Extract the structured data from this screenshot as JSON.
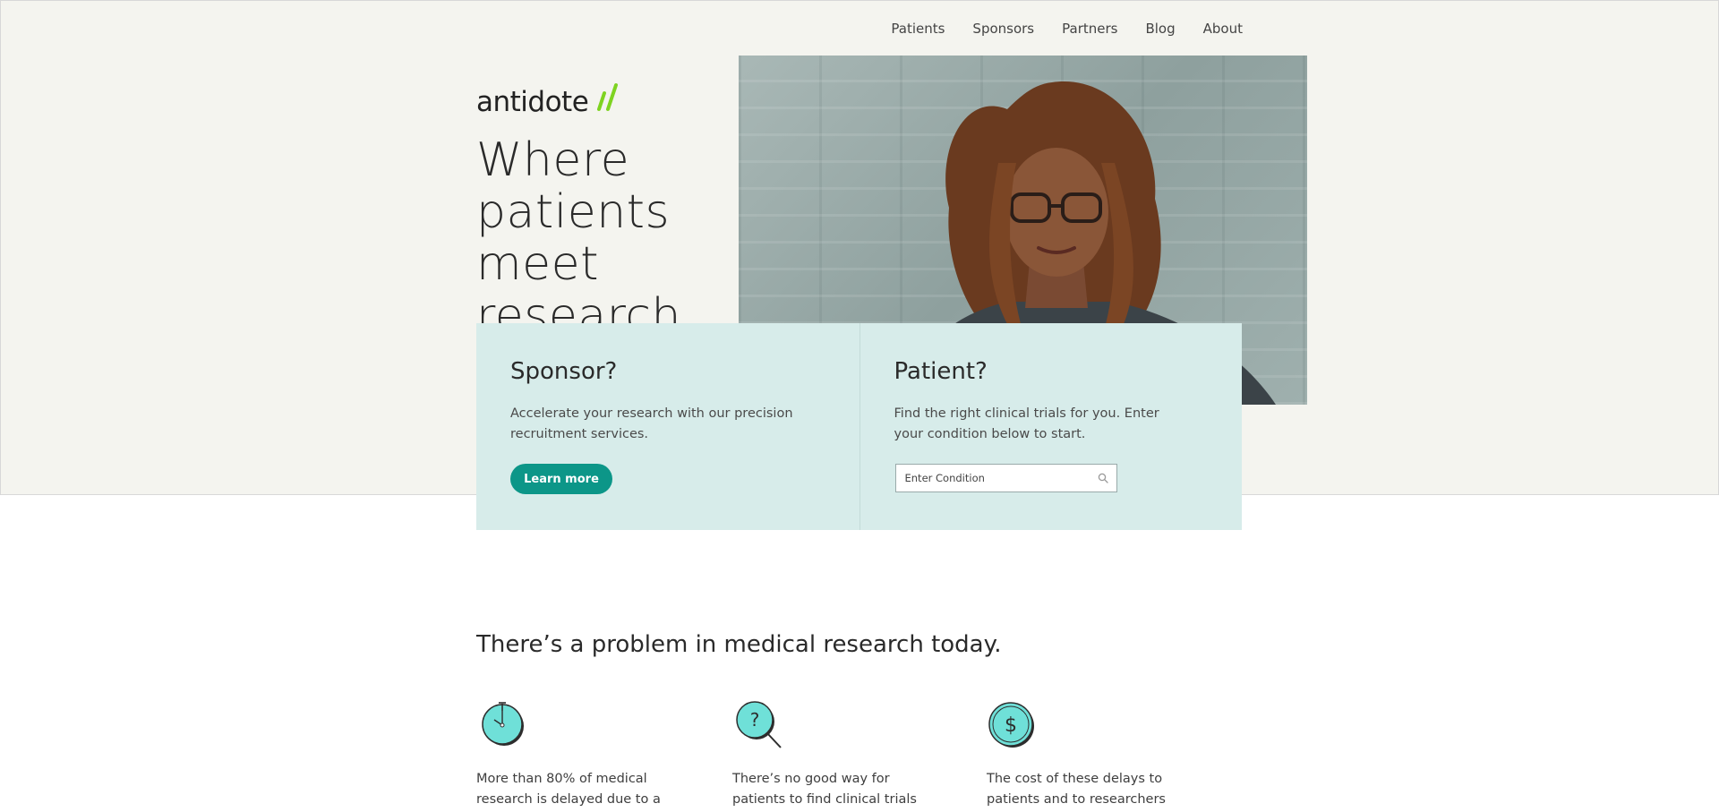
{
  "nav": {
    "items": [
      {
        "label": "Patients"
      },
      {
        "label": "Sponsors"
      },
      {
        "label": "Partners"
      },
      {
        "label": "Blog"
      },
      {
        "label": "About"
      }
    ]
  },
  "brand": {
    "logo_text": "antidote",
    "accent": "#7ed321"
  },
  "hero": {
    "headline": "Where patients meet research",
    "photo_icon": "person-portrait-photo"
  },
  "sponsor_card": {
    "title": "Sponsor?",
    "text": "Accelerate your research with our precision recruitment services.",
    "button_label": "Learn more"
  },
  "patient_card": {
    "title": "Patient?",
    "text": "Find the right clinical trials for you. Enter your condition below to start.",
    "search_placeholder": "Enter Condition",
    "search_value": ""
  },
  "problem": {
    "title": "There’s a problem in medical research today.",
    "features": [
      {
        "icon": "stopwatch-icon",
        "text": "More than 80% of medical research is delayed due to a"
      },
      {
        "icon": "magnifier-question-icon",
        "text": "There’s no good way for patients to find clinical trials"
      },
      {
        "icon": "dollar-coin-icon",
        "text": "The cost of these delays to patients and to researchers"
      }
    ]
  },
  "colors": {
    "hero_bg": "#f4f4ef",
    "card_bg": "#d7ecea",
    "button": "#0c9688",
    "icon_fill": "#6fe0d8"
  }
}
